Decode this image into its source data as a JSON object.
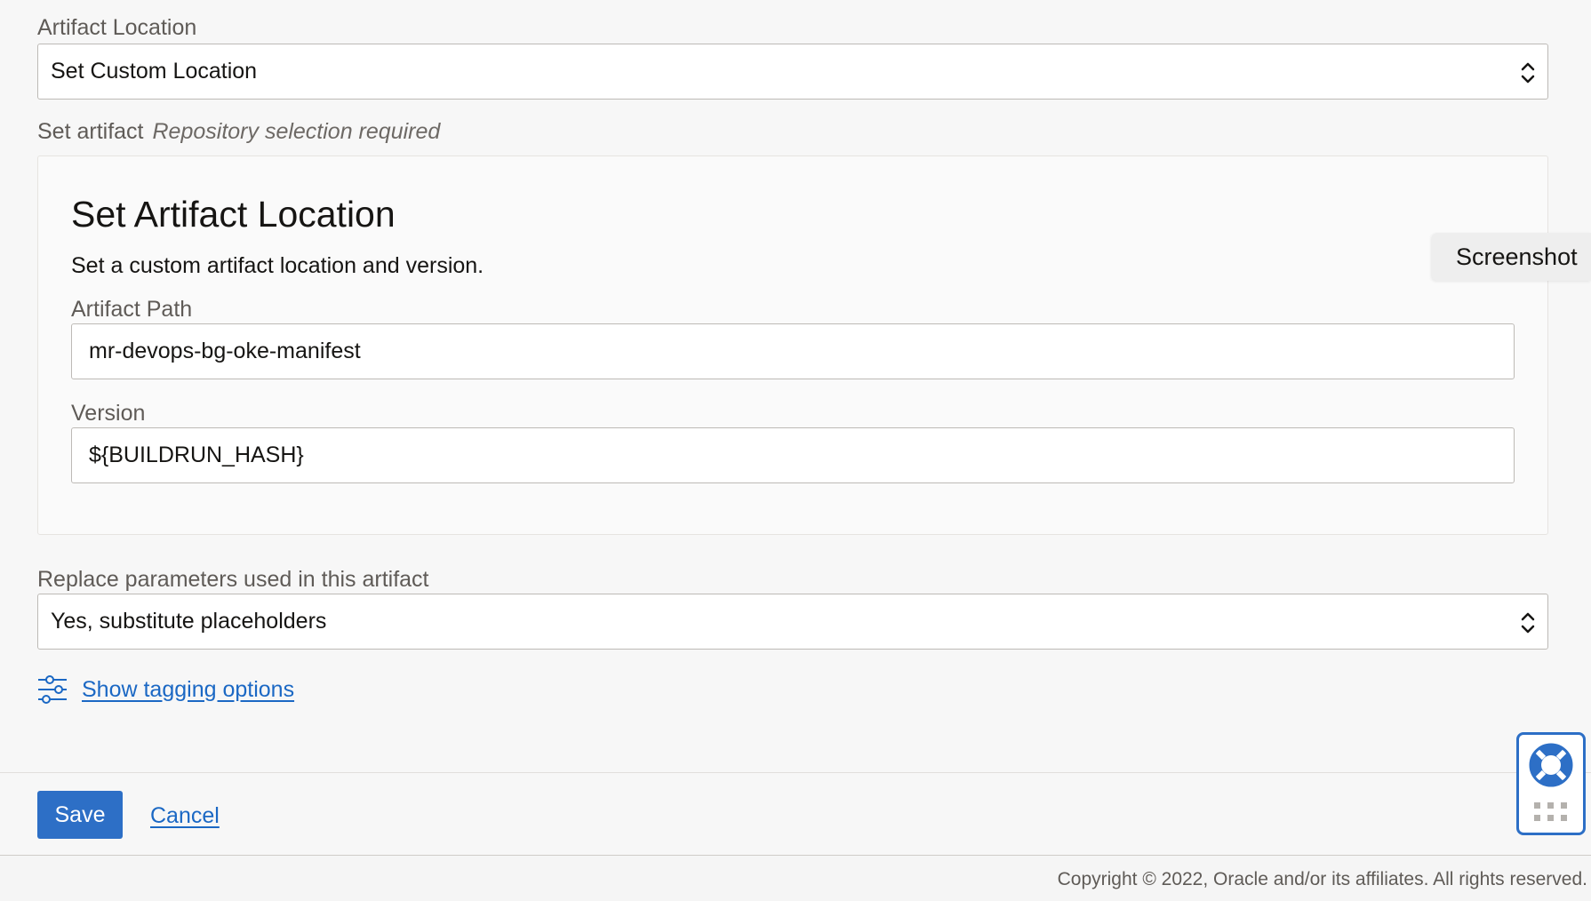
{
  "artifact_location": {
    "label": "Artifact Location",
    "selected": "Set Custom Location"
  },
  "set_artifact": {
    "label": "Set artifact",
    "note": "Repository selection required"
  },
  "panel": {
    "title": "Set Artifact Location",
    "description": "Set a custom artifact location and version.",
    "path_label": "Artifact Path",
    "path_value": "mr-devops-bg-oke-manifest",
    "version_label": "Version",
    "version_value": "${BUILDRUN_HASH}"
  },
  "replace_params": {
    "label": "Replace parameters used in this artifact",
    "selected": "Yes, substitute placeholders"
  },
  "tagging": {
    "link": "Show tagging options",
    "icon": "sliders-icon"
  },
  "footer": {
    "save_label": "Save",
    "cancel_label": "Cancel",
    "copyright": "Copyright © 2022, Oracle and/or its affiliates. All rights reserved."
  },
  "screenshot_tab": {
    "label": "Screenshot"
  },
  "help_widget": {
    "icon": "lifebuoy-icon",
    "grip_icon": "grip-dots-icon"
  },
  "colors": {
    "accent": "#2d6fc6",
    "link": "#1b68c4",
    "label_text": "#5f5b57",
    "background": "#f7f7f7"
  }
}
